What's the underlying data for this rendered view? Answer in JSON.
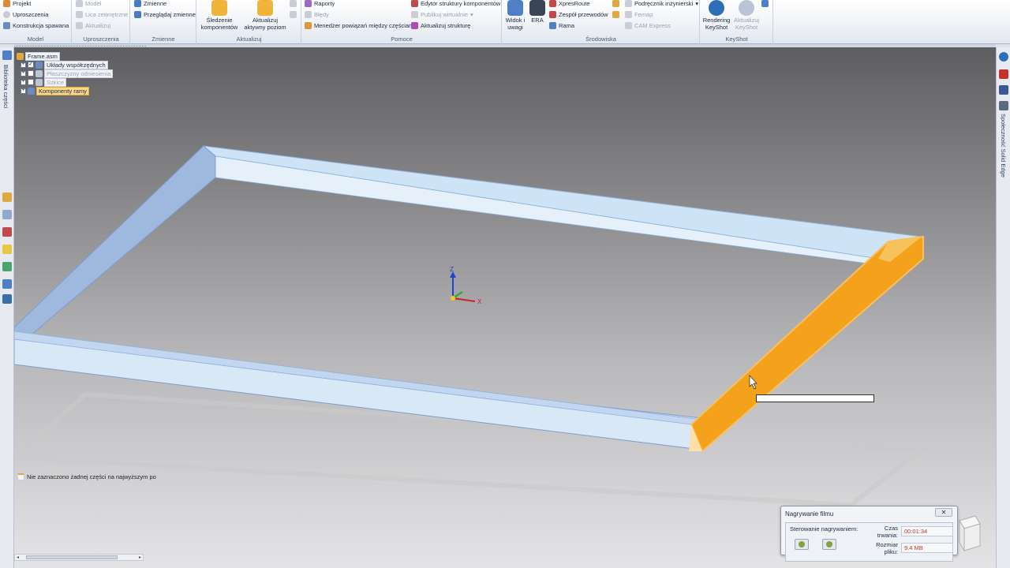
{
  "ribbon": {
    "model_group": {
      "label": "Model",
      "items": [
        "Projekt",
        "Uproszczenia",
        "Konstrukcja spawana"
      ]
    },
    "simplify_group": {
      "label": "Uproszczenia",
      "items": [
        "Model",
        "Lica zewnętrzne",
        "Aktualizuj"
      ]
    },
    "variables_group": {
      "label": "Zmienne",
      "items": [
        "Zmienne",
        "Przeglądaj zmienne"
      ]
    },
    "update_group": {
      "label": "Aktualizuj",
      "track_line1": "Śledzenie",
      "track_line2": "komponentów",
      "update_line1": "Aktualizuj",
      "update_line2": "aktywny poziom"
    },
    "help_group": {
      "label": "Pomoce",
      "left_items": [
        "Raporty",
        "Błędy",
        "Menedżer powiązań między częściami"
      ],
      "right_items": [
        "Edytor struktury komponentów",
        "Publikuj wirtualnie",
        "Aktualizuj strukturę"
      ]
    },
    "env_group": {
      "label": "Środowiska",
      "view_line1": "Widok i",
      "view_line2": "uwagi",
      "era": "ERA",
      "mid_items": [
        "XpresRoute",
        "Zespół przewodów",
        "Rama"
      ],
      "right_items": [
        "Podręcznik inżynierski",
        "Femap",
        "CAM Express"
      ]
    },
    "keyshot_group": {
      "label": "KeyShot",
      "render_line1": "Rendering",
      "render_line2": "KeyShot",
      "update_line1": "Aktualizuj",
      "update_line2": "KeyShot"
    }
  },
  "left_strip": {
    "label": "Biblioteka części"
  },
  "right_strip": {
    "label": "Społeczność Solid Edge"
  },
  "tree": {
    "root": "Frame.asm",
    "items": [
      "Układy współrzędnych",
      "Płaszczyzny odniesienia",
      "Szkice",
      "Komponenty ramy"
    ]
  },
  "status_message": "Nie zaznaczono żadnej części na najwyższym po",
  "triad": {
    "z": "Z",
    "x": "X"
  },
  "recording": {
    "title": "Nagrywanie filmu",
    "control_label": "Sterowanie nagrywaniem:",
    "duration_label": "Czas trwania:",
    "duration_value": "00:01:34",
    "size_label": "Rozmiar pliku:",
    "size_value": "9.4 MB"
  },
  "colors": {
    "frame_fill": "#cfe3f6",
    "frame_edge": "#8fb0db",
    "selected_member": "#f4a21c",
    "accent": "#e0a840"
  }
}
